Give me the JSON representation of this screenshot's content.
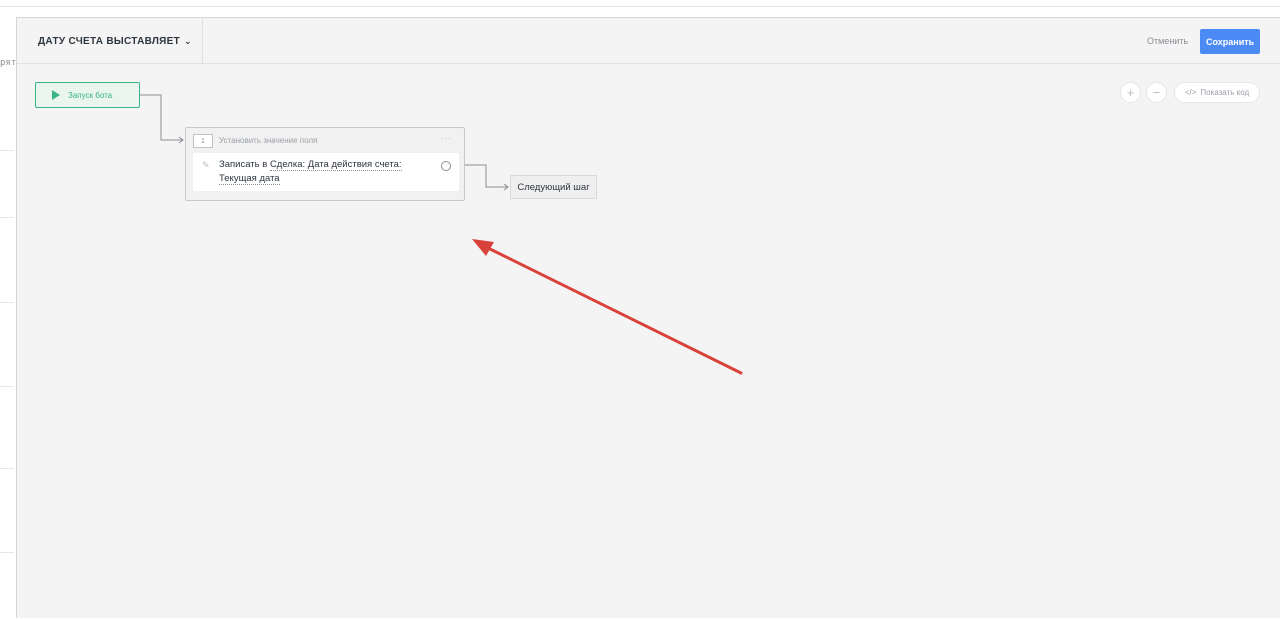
{
  "background": {
    "fragment_text": "рят"
  },
  "header": {
    "bot_title": "ДАТУ СЧЕТА ВЫСТАВЛЯЕТ",
    "cancel_label": "Отменить",
    "save_label": "Сохранить"
  },
  "canvas_controls": {
    "zoom_in": "+",
    "zoom_out": "−",
    "code_glyph": "</>",
    "show_code_label": "Показать код"
  },
  "flow": {
    "start_node_label": "Запуск бота",
    "step": {
      "number": "1",
      "title": "Установить значение поля",
      "menu": "···",
      "action_prefix": "Записать в ",
      "action_field": "Сделка: Дата действия счета:",
      "action_value": "Текущая дата"
    },
    "next_step_label": "Следующий шаг"
  },
  "colors": {
    "accent": "#4c8bf5",
    "start_node": "#38b584",
    "annotation_arrow": "#d9423a"
  }
}
